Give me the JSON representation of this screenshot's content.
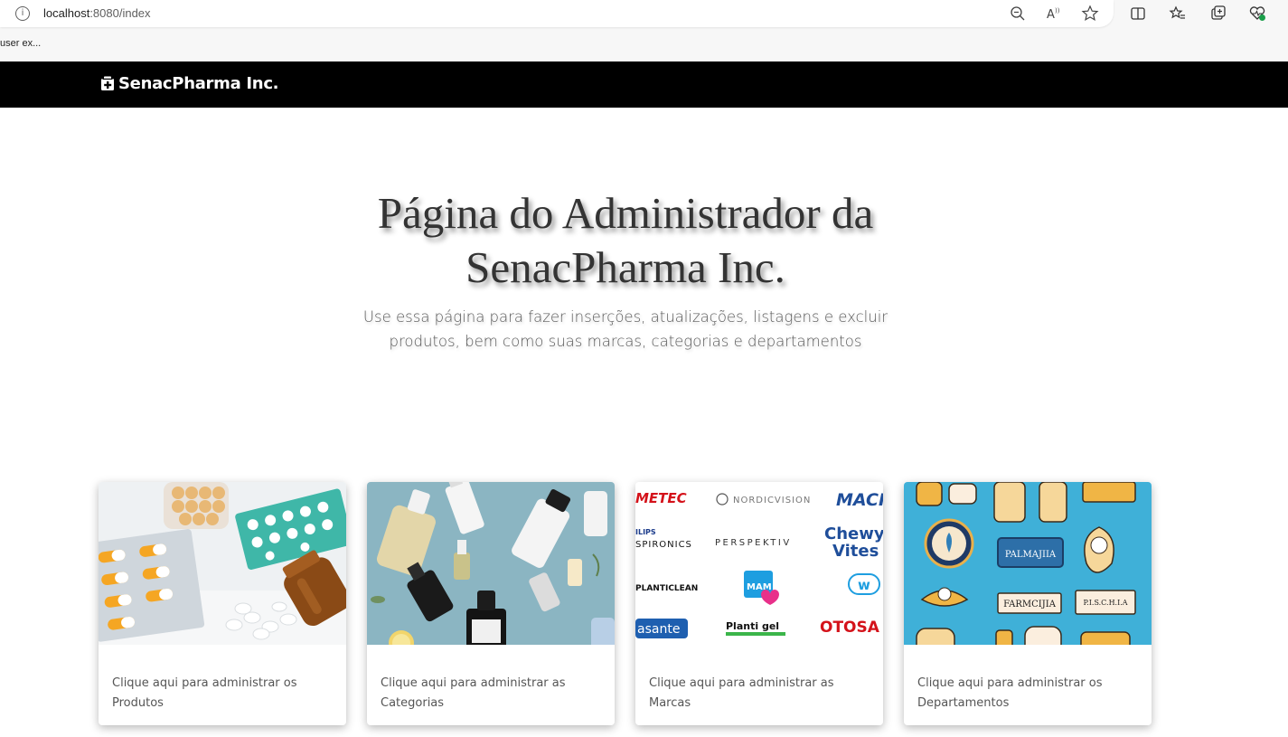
{
  "browser": {
    "url_host": "localhost",
    "url_rest": ":8080/index",
    "favorites_item": "user ex..."
  },
  "navbar": {
    "brand": "SenacPharma Inc."
  },
  "hero": {
    "title": "Página do Administrador da SenacPharma Inc.",
    "subtitle": "Use essa página para fazer inserções, atualizações, listagens e excluir produtos, bem como suas marcas, categorias e departamentos"
  },
  "cards": [
    {
      "text": "Clique aqui para administrar os Produtos"
    },
    {
      "text": "Clique aqui para administrar as Categorias"
    },
    {
      "text": "Clique aqui para administrar as Marcas"
    },
    {
      "text": "Clique aqui para administrar os Departamentos"
    }
  ],
  "brand_logos": {
    "metec": "METEC",
    "nordicvision": "NORDICVISION",
    "macks": "MACK'S",
    "philips_line1": "ILIPS",
    "philips_line2": "SPIRONICS",
    "perspektiv": "PERSPEKTIV",
    "chewy1": "Chewy",
    "chewy2": "Vites",
    "planticlean": "PLANTICLEAN",
    "mam": "MAM",
    "asante": "asante",
    "plantigel": "Planti gel",
    "otosan": "OTOSA"
  },
  "dept_labels": {
    "label1": "PALMAJIIA",
    "label2": "FARMCIJIA",
    "label3": "P.I.S.C.H.I.A"
  },
  "colors": {
    "navbar_bg": "#000000",
    "card_text": "#555555",
    "hero_text": "#333333"
  }
}
